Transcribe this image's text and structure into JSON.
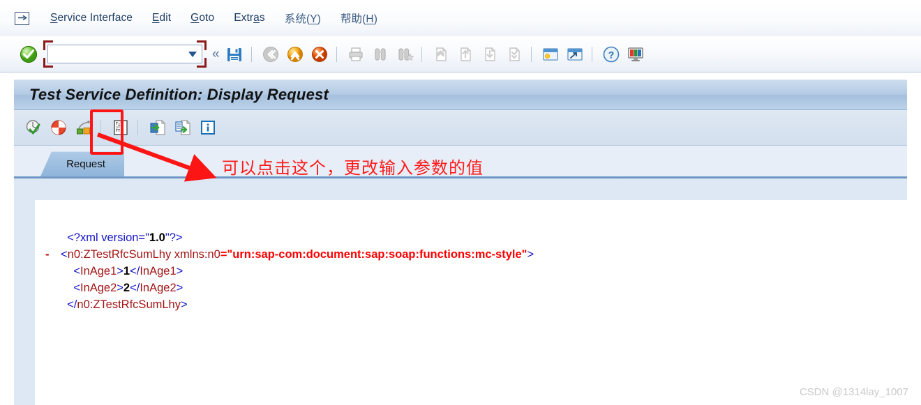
{
  "window": {
    "system_icon": "sap-exit-icon"
  },
  "menubar": {
    "items": [
      {
        "id": "service-interface",
        "pre": "",
        "key": "S",
        "post": "ervice Interface",
        "cjk": false
      },
      {
        "id": "edit",
        "pre": "",
        "key": "E",
        "post": "dit",
        "cjk": false
      },
      {
        "id": "goto",
        "pre": "",
        "key": "G",
        "post": "oto",
        "cjk": false
      },
      {
        "id": "extras",
        "pre": "Extr",
        "key": "a",
        "post": "s",
        "cjk": false
      },
      {
        "id": "system",
        "pre": "系统(",
        "key": "Y",
        "post": ")",
        "cjk": true
      },
      {
        "id": "help",
        "pre": "帮助(",
        "key": "H",
        "post": ")",
        "cjk": true
      }
    ]
  },
  "toolbar": {
    "enter_icon": "enter-check-icon",
    "command_field": {
      "value": "",
      "placeholder": ""
    },
    "dropdown_icon": "chevron-down-icon",
    "collapse_icon": "«",
    "icons": [
      "save-icon",
      "back-icon",
      "exit-icon",
      "cancel-icon",
      "print-icon",
      "find-icon",
      "find-next-icon",
      "first-page-icon",
      "previous-page-icon",
      "next-page-icon",
      "last-page-icon",
      "create-session-icon",
      "create-shortcut-icon",
      "help-icon",
      "customize-local-layout-icon"
    ]
  },
  "title": {
    "text": "Test Service Definition: Display Request"
  },
  "app_toolbar": {
    "icons": [
      "check-service-icon",
      "execute-icon",
      "configuration-icon",
      "edit-parameters-icon",
      "open-xml-request-icon",
      "open-xml-response-icon",
      "info-icon"
    ],
    "highlighted_icon": "edit-parameters-icon"
  },
  "tabs": {
    "items": [
      {
        "id": "request",
        "label": "Request",
        "active": true
      }
    ]
  },
  "xml_document": {
    "lines": [
      {
        "gutter": "",
        "indent": 1,
        "parts": [
          {
            "t": "tg",
            "s": "<?xml version="
          },
          {
            "t": "tg",
            "s": "\""
          },
          {
            "t": "tx",
            "s": "1.0"
          },
          {
            "t": "tg",
            "s": "\"?>"
          }
        ]
      },
      {
        "gutter": "-",
        "indent": 0,
        "parts": [
          {
            "t": "tg",
            "s": "<"
          },
          {
            "t": "nm",
            "s": "n0:ZTestRfcSumLhy"
          },
          {
            "t": "tg",
            "s": " "
          },
          {
            "t": "at",
            "s": "xmlns:n0"
          },
          {
            "t": "av",
            "s": "="
          },
          {
            "t": "av",
            "s": "\"urn:sap-com:document:sap:soap:functions:mc-style\""
          },
          {
            "t": "tg",
            "s": ">"
          }
        ]
      },
      {
        "gutter": "",
        "indent": 2,
        "parts": [
          {
            "t": "tg",
            "s": "<"
          },
          {
            "t": "nm",
            "s": "InAge1"
          },
          {
            "t": "tg",
            "s": ">"
          },
          {
            "t": "tx",
            "s": "1"
          },
          {
            "t": "tg",
            "s": "</"
          },
          {
            "t": "nm",
            "s": "InAge1"
          },
          {
            "t": "tg",
            "s": ">"
          }
        ]
      },
      {
        "gutter": "",
        "indent": 2,
        "parts": [
          {
            "t": "tg",
            "s": "<"
          },
          {
            "t": "nm",
            "s": "InAge2"
          },
          {
            "t": "tg",
            "s": ">"
          },
          {
            "t": "tx",
            "s": "2"
          },
          {
            "t": "tg",
            "s": "</"
          },
          {
            "t": "nm",
            "s": "InAge2"
          },
          {
            "t": "tg",
            "s": ">"
          }
        ]
      },
      {
        "gutter": "",
        "indent": 1,
        "parts": [
          {
            "t": "tg",
            "s": "</"
          },
          {
            "t": "nm",
            "s": "n0:ZTestRfcSumLhy"
          },
          {
            "t": "tg",
            "s": ">"
          }
        ]
      }
    ]
  },
  "annotations": {
    "note_text": "可以点击这个，更改输入参数的值",
    "note_color": "#ff1a1a",
    "highlight_color": "#fb1515",
    "arrow": "red-arrow-pointing-to-note"
  },
  "watermark": {
    "text": "CSDN @1314lay_1007"
  },
  "colors": {
    "title_band": "#a5c0dd",
    "app_toolbar": "#d2dfee",
    "tab_active": "#8eb4da",
    "content_bg": "#dde8f4",
    "xml_tag": "#1414c8",
    "xml_name": "#a21414",
    "xml_value": "#ff0000"
  }
}
